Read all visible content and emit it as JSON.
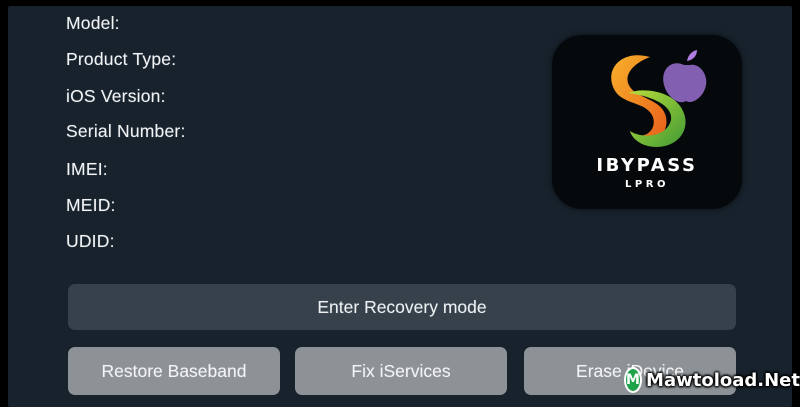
{
  "device_info": {
    "rows": [
      {
        "label": "Model:",
        "value": ""
      },
      {
        "label": "Product Type:",
        "value": ""
      },
      {
        "label": "iOS Version:",
        "value": ""
      },
      {
        "label": "Serial Number:",
        "value": ""
      },
      {
        "label": "IMEI:",
        "value": ""
      },
      {
        "label": "MEID:",
        "value": ""
      },
      {
        "label": "UDID:",
        "value": ""
      }
    ]
  },
  "logo": {
    "name": "IBYPASS",
    "sub": "LPRO",
    "icon": "ibypass-swirl-logo",
    "colors": {
      "orange": "#f08a1e",
      "green": "#7cc23a",
      "tile": "#06090c"
    }
  },
  "actions": {
    "recovery_label": "Enter Recovery mode",
    "baseband_label": "Restore Baseband",
    "services_label": "Fix iServices",
    "erase_label": "Erase iDevice"
  },
  "watermark": {
    "badge": "M",
    "text": "Mawtoload.Net"
  },
  "theme": {
    "background": "#17222c",
    "primary_button": "#36414b",
    "secondary_button": "#8d9296"
  }
}
